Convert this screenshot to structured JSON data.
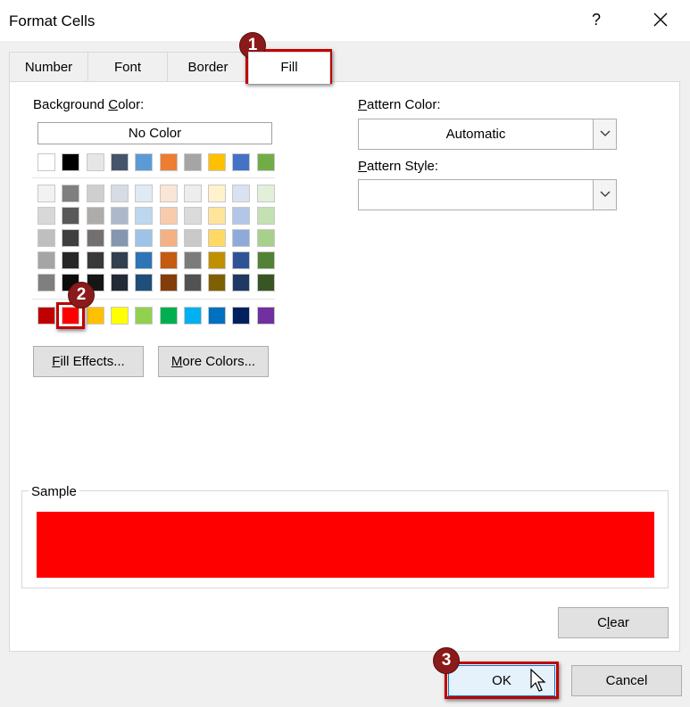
{
  "window": {
    "title": "Format Cells",
    "help_glyph": "?",
    "close_icon": "close-icon"
  },
  "tabs": [
    {
      "label": "Number",
      "active": false
    },
    {
      "label": "Font",
      "active": false
    },
    {
      "label": "Border",
      "active": false
    },
    {
      "label": "Fill",
      "active": true
    }
  ],
  "fill": {
    "background_color": {
      "label_pre": "Background ",
      "label_key": "C",
      "label_post": "olor:",
      "no_color": "No Color",
      "theme_row": [
        "#ffffff",
        "#000000",
        "#e7e6e6",
        "#44546a",
        "#5b9bd5",
        "#ed7d31",
        "#a5a5a5",
        "#ffc000",
        "#4472c4",
        "#70ad47"
      ],
      "tint_rows": [
        [
          "#f2f2f2",
          "#7f7f7f",
          "#d0cece",
          "#d6dce4",
          "#deebf6",
          "#fbe5d5",
          "#ededed",
          "#fff2cc",
          "#d9e2f3",
          "#e2efd9"
        ],
        [
          "#d8d8d8",
          "#595959",
          "#aeabab",
          "#adb9ca",
          "#bdd7ee",
          "#f8cbad",
          "#dbdbdb",
          "#ffe599",
          "#b4c6e7",
          "#c5e0b3"
        ],
        [
          "#bfbfbf",
          "#3f3f3f",
          "#757070",
          "#8496b0",
          "#9dc3e6",
          "#f4b183",
          "#c9c9c9",
          "#ffd965",
          "#8eaadb",
          "#a8d08d"
        ],
        [
          "#a5a5a5",
          "#262626",
          "#3a3838",
          "#323f4f",
          "#2e75b5",
          "#c55a11",
          "#7b7b7b",
          "#bf9000",
          "#2f5496",
          "#538135"
        ],
        [
          "#7f7f7f",
          "#0c0c0c",
          "#171616",
          "#222a35",
          "#1e4e79",
          "#843c0b",
          "#525252",
          "#7f6000",
          "#1f3864",
          "#375623"
        ]
      ],
      "standard_row": [
        "#c00000",
        "#ff0000",
        "#ffc000",
        "#ffff00",
        "#92d050",
        "#00b050",
        "#00b0f0",
        "#0070c0",
        "#002060",
        "#7030a0"
      ],
      "selected_color": "#ff0000"
    },
    "fill_effects": {
      "pre": "",
      "key": "F",
      "post": "ill Effects..."
    },
    "more_colors": {
      "pre": "",
      "key": "M",
      "post": "ore Colors..."
    },
    "pattern_color": {
      "label_pre": "",
      "label_key": "P",
      "label_post": "attern Color:",
      "value": "Automatic"
    },
    "pattern_style": {
      "label_pre": "",
      "label_key": "P",
      "label_post": "attern Style:",
      "value": ""
    },
    "sample": {
      "label": "Sample",
      "color": "#ff0000"
    },
    "clear": {
      "pre": "C",
      "key": "l",
      "post": "ear"
    }
  },
  "footer": {
    "ok_label": "OK",
    "cancel_label": "Cancel"
  },
  "annotations": {
    "step1": "1",
    "step2": "2",
    "step3": "3",
    "highlight_color": "#c00000"
  }
}
